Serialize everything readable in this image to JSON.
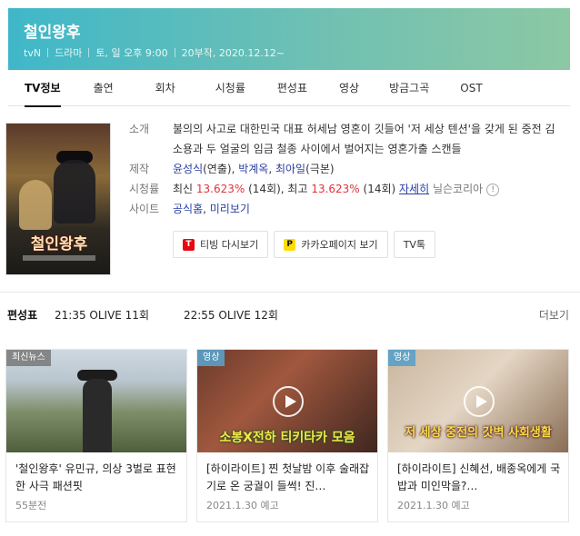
{
  "header": {
    "title": "철인왕후",
    "channel": "tvN",
    "genre": "드라마",
    "airtime": "토, 일 오후 9:00",
    "episodes": "20부작, 2020.12.12~"
  },
  "tabs": [
    "TV정보",
    "출연",
    "회차",
    "시청률",
    "편성표",
    "영상",
    "방금그곡",
    "OST"
  ],
  "info": {
    "synopsis_label": "소개",
    "synopsis": "불의의 사고로 대한민국 대표 허세남 영혼이 깃들어 '저 세상 텐션'을 갖게 된 중전 김소용과 두 얼굴의 임금 철종 사이에서 벌어지는 영혼가출 스캔들",
    "staff_label": "제작",
    "staff_1": "윤성식",
    "staff_1_role": "(연출), ",
    "staff_2": "박계옥",
    "staff_2_sep": ", ",
    "staff_3": "최아일",
    "staff_3_role": "(극본)",
    "rating_label": "시청률",
    "rating_latest_prefix": "최신 ",
    "rating_latest": "13.623%",
    "rating_latest_ep": " (14회), 최고 ",
    "rating_max": "13.623%",
    "rating_max_ep": " (14회) ",
    "rating_source": "자세히",
    "rating_company": " 닐슨코리아",
    "site_label": "사이트",
    "site_1": "공식홈",
    "site_sep": ", ",
    "site_2": "미리보기",
    "poster_title": "철인왕후"
  },
  "buttons": {
    "tving": "티빙 다시보기",
    "kakao": "카카오페이지 보기",
    "tvtalk": "TV톡"
  },
  "schedule": {
    "label": "편성표",
    "item_1": "21:35 OLIVE 11회",
    "item_2": "22:55 OLIVE 12회",
    "more": "더보기"
  },
  "cards": [
    {
      "badge": "최신뉴스",
      "title": "'철인왕후' 유민규, 의상 3벌로 표현한 사극 패션핏",
      "date": "55분전"
    },
    {
      "badge": "영상",
      "caption": "소봉X전하 티키타카 모음",
      "title": "[하이라이트] 찐 첫날밤 이후 술래잡기로 온 궁궐이 들썩! 진…",
      "date": "2021.1.30 예고"
    },
    {
      "badge": "영상",
      "caption": "저 세상 중전의 갓벽 사회생활",
      "title": "[하이라이트] 신혜선, 배종옥에게 국밥과 미인막을?…",
      "date": "2021.1.30 예고"
    }
  ],
  "colors": {
    "hero_start": "#3fb7c9",
    "hero_end": "#8cc8a4",
    "link": "#2a3fa3",
    "rating": "#e2333c"
  }
}
